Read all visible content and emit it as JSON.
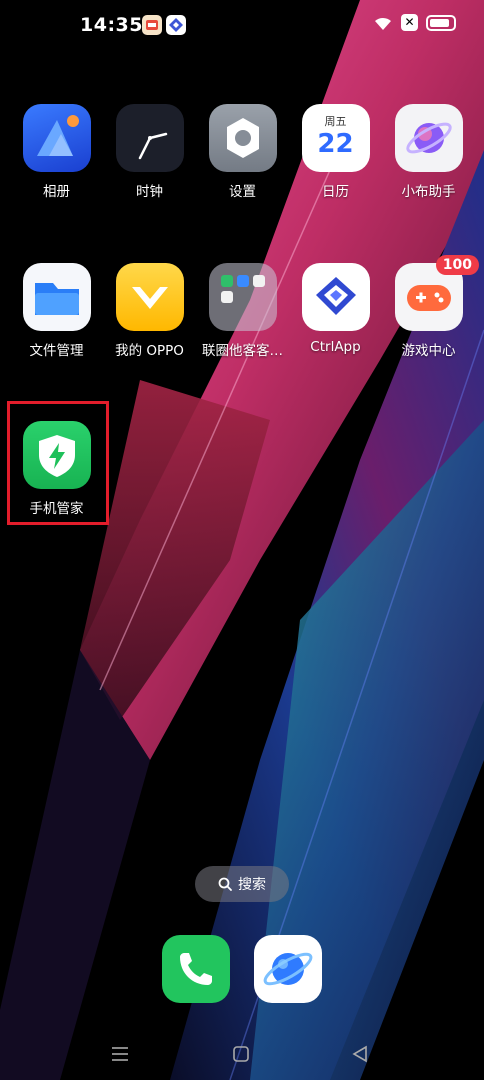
{
  "status_bar": {
    "time": "14:35",
    "battery_level": 0.85
  },
  "apps_row1": [
    {
      "label": "相册",
      "icon": "photos-icon"
    },
    {
      "label": "时钟",
      "icon": "clock-icon"
    },
    {
      "label": "设置",
      "icon": "settings-gear-icon"
    },
    {
      "label": "日历",
      "icon": "calendar-icon",
      "weekday": "周五",
      "day": "22"
    },
    {
      "label": "小布助手",
      "icon": "assistant-planet-icon"
    }
  ],
  "apps_row2": [
    {
      "label": "文件管理",
      "icon": "folder-icon"
    },
    {
      "label": "我的 OPPO",
      "icon": "oppo-heart-icon"
    },
    {
      "label": "联圈他客客…",
      "icon": "app-folder-icon"
    },
    {
      "label": "CtrlApp",
      "icon": "ctrlapp-cube-icon"
    },
    {
      "label": "游戏中心",
      "icon": "gamepad-icon",
      "badge": "100"
    }
  ],
  "apps_row3": [
    {
      "label": "手机管家",
      "icon": "phone-manager-shield-icon",
      "highlighted": true
    }
  ],
  "search": {
    "label": "搜索"
  },
  "dock": [
    {
      "name": "phone",
      "icon": "phone-handset-icon"
    },
    {
      "name": "browser",
      "icon": "browser-planet-icon"
    }
  ],
  "colors": {
    "highlight_border": "#e31d2b",
    "badge": "#ef3b47",
    "phone_manager_green": "#1ec05a",
    "dock_phone_green": "#22c55e"
  }
}
